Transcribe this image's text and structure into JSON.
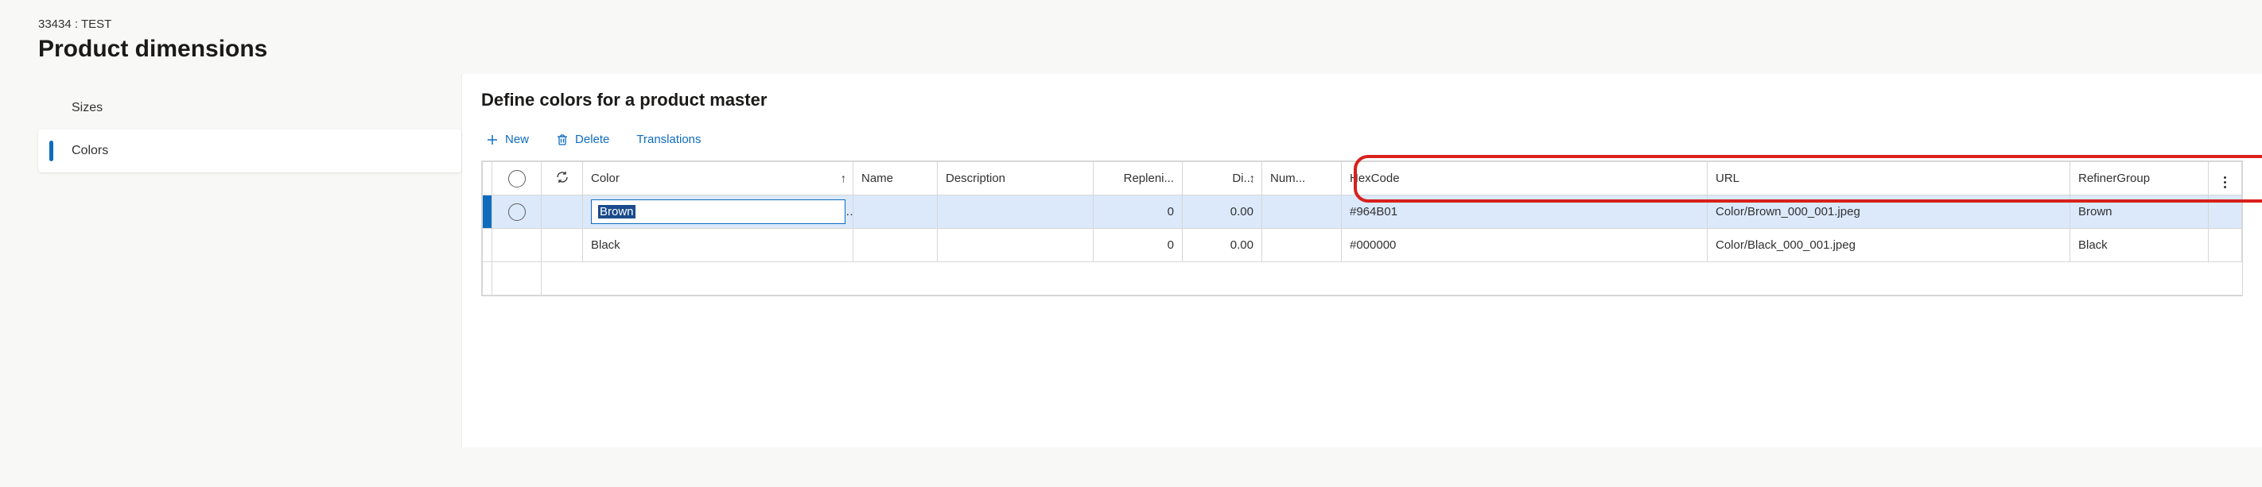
{
  "header": {
    "breadcrumb": "33434 : TEST",
    "title": "Product dimensions"
  },
  "sidebar": {
    "items": [
      {
        "label": "Sizes",
        "active": false
      },
      {
        "label": "Colors",
        "active": true
      }
    ]
  },
  "main": {
    "section_title": "Define colors for a product master",
    "toolbar": {
      "new_label": "New",
      "delete_label": "Delete",
      "trans_label": "Translations"
    },
    "grid": {
      "columns": {
        "color": "Color",
        "name": "Name",
        "description": "Description",
        "replenish": "Repleni...",
        "display": "Di...",
        "number": "Num...",
        "hexcode": "HexCode",
        "url": "URL",
        "refinergroup": "RefinerGroup"
      },
      "rows": [
        {
          "selected": true,
          "editing": true,
          "color": "Brown",
          "name": "",
          "description": "",
          "replenish": "0",
          "display": "0.00",
          "number": "",
          "hexcode": "#964B01",
          "url": "Color/Brown_000_001.jpeg",
          "refinergroup": "Brown"
        },
        {
          "selected": false,
          "editing": false,
          "color": "Black",
          "name": "",
          "description": "",
          "replenish": "0",
          "display": "0.00",
          "number": "",
          "hexcode": "#000000",
          "url": "Color/Black_000_001.jpeg",
          "refinergroup": "Black"
        }
      ]
    }
  }
}
